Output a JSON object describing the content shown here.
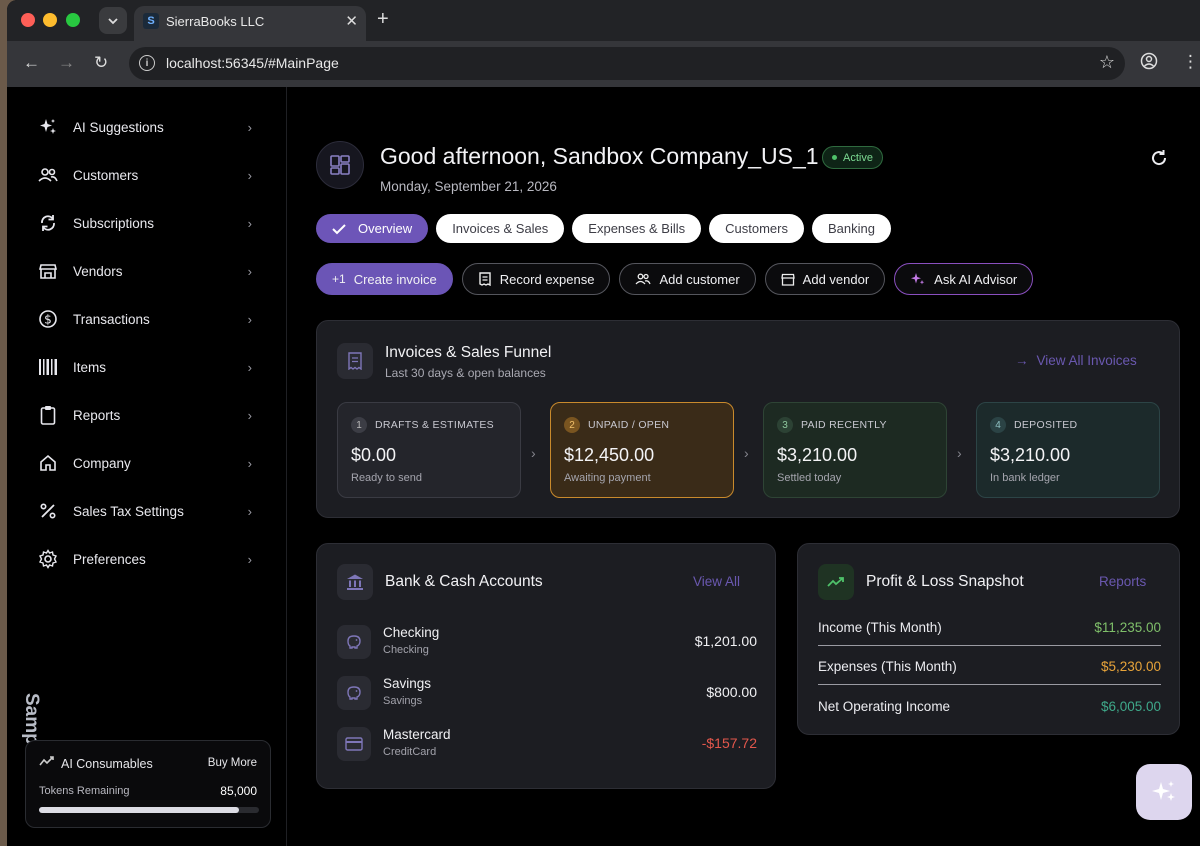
{
  "browser": {
    "tab_title": "SierraBooks LLC",
    "url": "localhost:56345/#MainPage"
  },
  "sidebar": {
    "items": [
      {
        "label": "AI Suggestions",
        "icon": "sparkles-icon"
      },
      {
        "label": "Customers",
        "icon": "people-icon"
      },
      {
        "label": "Subscriptions",
        "icon": "refresh-icon"
      },
      {
        "label": "Vendors",
        "icon": "store-icon"
      },
      {
        "label": "Transactions",
        "icon": "dollar-circle-icon"
      },
      {
        "label": "Items",
        "icon": "barcode-icon"
      },
      {
        "label": "Reports",
        "icon": "clipboard-icon"
      },
      {
        "label": "Company",
        "icon": "home-icon"
      },
      {
        "label": "Sales Tax Settings",
        "icon": "percent-icon"
      },
      {
        "label": "Preferences",
        "icon": "gear-icon"
      }
    ],
    "sample_label": "Sample Data",
    "consumables": {
      "title": "AI Consumables",
      "buy_label": "Buy More",
      "tokens_label": "Tokens Remaining",
      "tokens_value": "85,000",
      "fill_fraction": 0.91
    }
  },
  "header": {
    "greeting": "Good afternoon, Sandbox Company_US_1",
    "badge": "Active",
    "date": "Monday, September 21, 2026"
  },
  "tabs": [
    "Overview",
    "Invoices & Sales",
    "Expenses & Bills",
    "Customers",
    "Banking"
  ],
  "actions": {
    "create_invoice": "Create invoice",
    "record_expense": "Record expense",
    "add_customer": "Add customer",
    "add_vendor": "Add vendor",
    "ask_ai": "Ask AI Advisor"
  },
  "funnel": {
    "title": "Invoices & Sales Funnel",
    "subtitle": "Last 30 days & open balances",
    "link": "View All Invoices",
    "stages": [
      {
        "num": "1",
        "label": "DRAFTS & ESTIMATES",
        "amount": "$0.00",
        "status": "Ready to send"
      },
      {
        "num": "2",
        "label": "UNPAID / OPEN",
        "amount": "$12,450.00",
        "status": "Awaiting payment"
      },
      {
        "num": "3",
        "label": "PAID RECENTLY",
        "amount": "$3,210.00",
        "status": "Settled today"
      },
      {
        "num": "4",
        "label": "DEPOSITED",
        "amount": "$3,210.00",
        "status": "In bank ledger"
      }
    ]
  },
  "bank": {
    "title": "Bank & Cash Accounts",
    "link": "View All",
    "accounts": [
      {
        "name": "Checking",
        "type": "Checking",
        "balance": "$1,201.00"
      },
      {
        "name": "Savings",
        "type": "Savings",
        "balance": "$800.00"
      },
      {
        "name": "Mastercard",
        "type": "CreditCard",
        "balance": "-$157.72"
      }
    ]
  },
  "pl": {
    "title": "Profit & Loss Snapshot",
    "link": "Reports",
    "rows": [
      {
        "label": "Income (This Month)",
        "value": "$11,235.00",
        "color": "#7fbf6a"
      },
      {
        "label": "Expenses (This Month)",
        "value": "$5,230.00",
        "color": "#e8a43a"
      },
      {
        "label": "Net Operating Income",
        "value": "$6,005.00",
        "color": "#3fa98a"
      }
    ]
  }
}
